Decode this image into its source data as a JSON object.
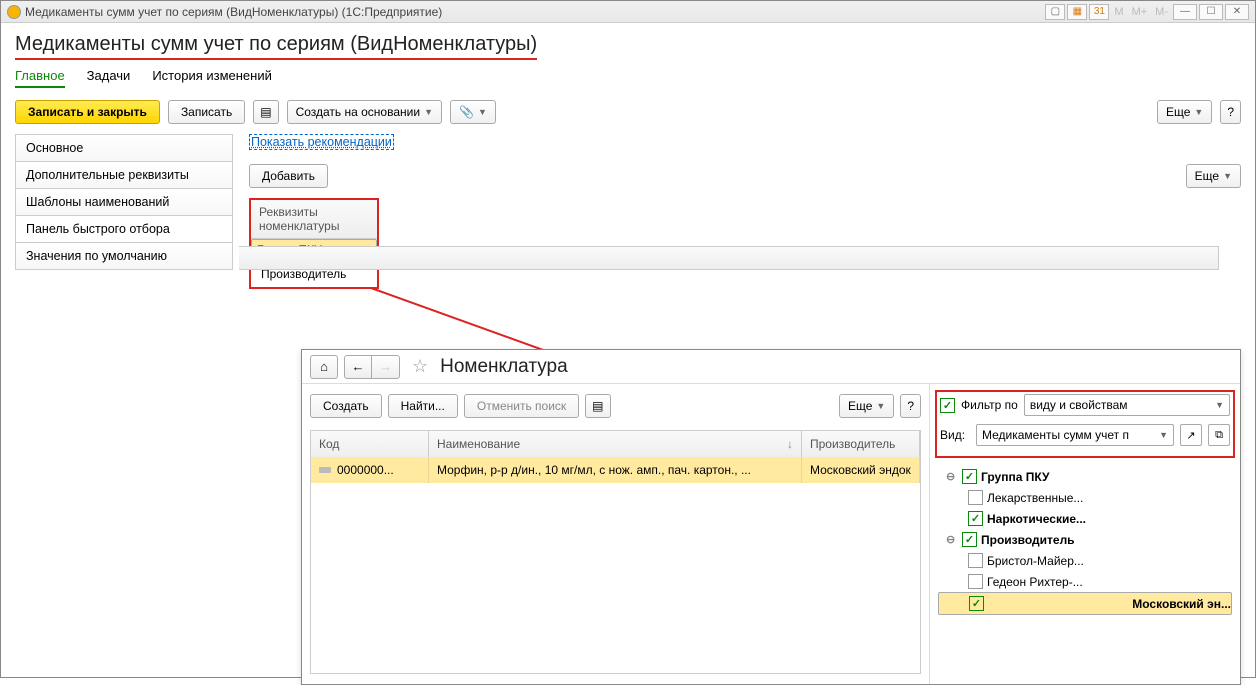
{
  "window": {
    "title": "Медикаменты сумм учет по сериям (ВидНоменклатуры)  (1С:Предприятие)",
    "mem": [
      "M",
      "M+",
      "M-"
    ]
  },
  "page_title": "Медикаменты сумм учет по сериям (ВидНоменклатуры)",
  "nav": {
    "main": "Главное",
    "tasks": "Задачи",
    "history": "История изменений"
  },
  "toolbar": {
    "save_close": "Записать и закрыть",
    "save": "Записать",
    "create_based": "Создать на основании",
    "more": "Еще",
    "help": "?"
  },
  "left_menu": {
    "items": [
      "Основное",
      "Дополнительные реквизиты",
      "Шаблоны наименований",
      "Панель быстрого отбора",
      "Значения по умолчанию"
    ]
  },
  "right": {
    "recommend": "Показать рекомендации",
    "add": "Добавить",
    "more": "Еще"
  },
  "rekv": {
    "header": "Реквизиты номенклатуры",
    "rows": [
      "Группа ПКУ",
      "Производитель"
    ]
  },
  "inner": {
    "title": "Номенклатура",
    "tools": {
      "create": "Создать",
      "find": "Найти...",
      "cancel": "Отменить поиск",
      "more": "Еще",
      "help": "?"
    },
    "grid": {
      "code_h": "Код",
      "name_h": "Наименование",
      "manuf_h": "Производитель",
      "row": {
        "code": "0000000...",
        "name": "Морфин, р-р д/ин., 10 мг/мл, с нож. амп., пач. картон., ...",
        "manuf": "Московский эндок"
      }
    },
    "filter": {
      "filter_by": "Фильтр по",
      "filter_val": "виду и свойствам",
      "view": "Вид:",
      "view_val": "Медикаменты сумм учет п"
    },
    "tree": {
      "g1": "Группа ПКУ",
      "g1a": "Лекарственные...",
      "g1b": "Наркотические...",
      "g2": "Производитель",
      "g2a": "Бристол-Майер...",
      "g2b": "Гедеон Рихтер-...",
      "g2c": "Московский эн..."
    }
  }
}
